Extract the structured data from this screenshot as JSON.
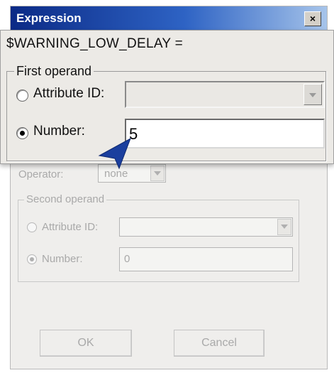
{
  "window": {
    "title": "Expression",
    "close_glyph": "×"
  },
  "callout": {
    "expression": "$WARNING_LOW_DELAY  =",
    "first_operand": {
      "legend": "First operand",
      "attribute_label": "Attribute ID:",
      "attribute_value": "",
      "number_label": "Number:",
      "number_value": "5",
      "selected": "number"
    }
  },
  "dialog": {
    "operator_label": "Operator:",
    "operator_value": "none",
    "second_operand": {
      "legend": "Second operand",
      "attribute_label": "Attribute ID:",
      "attribute_value": "",
      "number_label": "Number:",
      "number_value": "0",
      "selected": "number"
    },
    "ok_label": "OK",
    "cancel_label": "Cancel"
  },
  "colors": {
    "titlebar_start": "#0b2a86",
    "titlebar_end": "#a6c4ea",
    "pointer": "#1b3f9e"
  },
  "icons": [
    "close-icon",
    "chevron-down-icon",
    "pointer-arrow-icon"
  ]
}
